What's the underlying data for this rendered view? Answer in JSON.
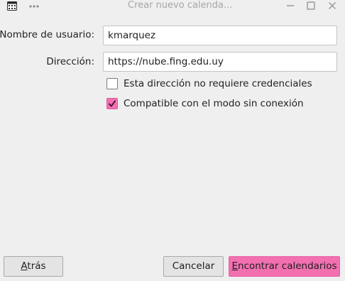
{
  "window": {
    "title": "Crear nuevo calenda...",
    "app_icon": "calendar-icon",
    "menu_icon": "more-dots-icon",
    "controls": [
      "minimize-icon",
      "maximize-icon",
      "close-icon"
    ]
  },
  "form": {
    "username_label": "Nombre de usuario:",
    "username_value": "kmarquez",
    "address_label": "Dirección:",
    "address_value": "https://nube.fing.edu.uy",
    "no_credentials_label": "Esta dirección no requiere credenciales",
    "no_credentials_checked": false,
    "offline_label": "Compatible con el modo sin conexión",
    "offline_checked": true
  },
  "buttons": {
    "back_first": "A",
    "back_rest": "trás",
    "cancel": "Cancelar",
    "find_first": "E",
    "find_rest": "ncontrar calendarios"
  },
  "colors": {
    "accent": "#f26fb0",
    "background": "#efefef"
  }
}
